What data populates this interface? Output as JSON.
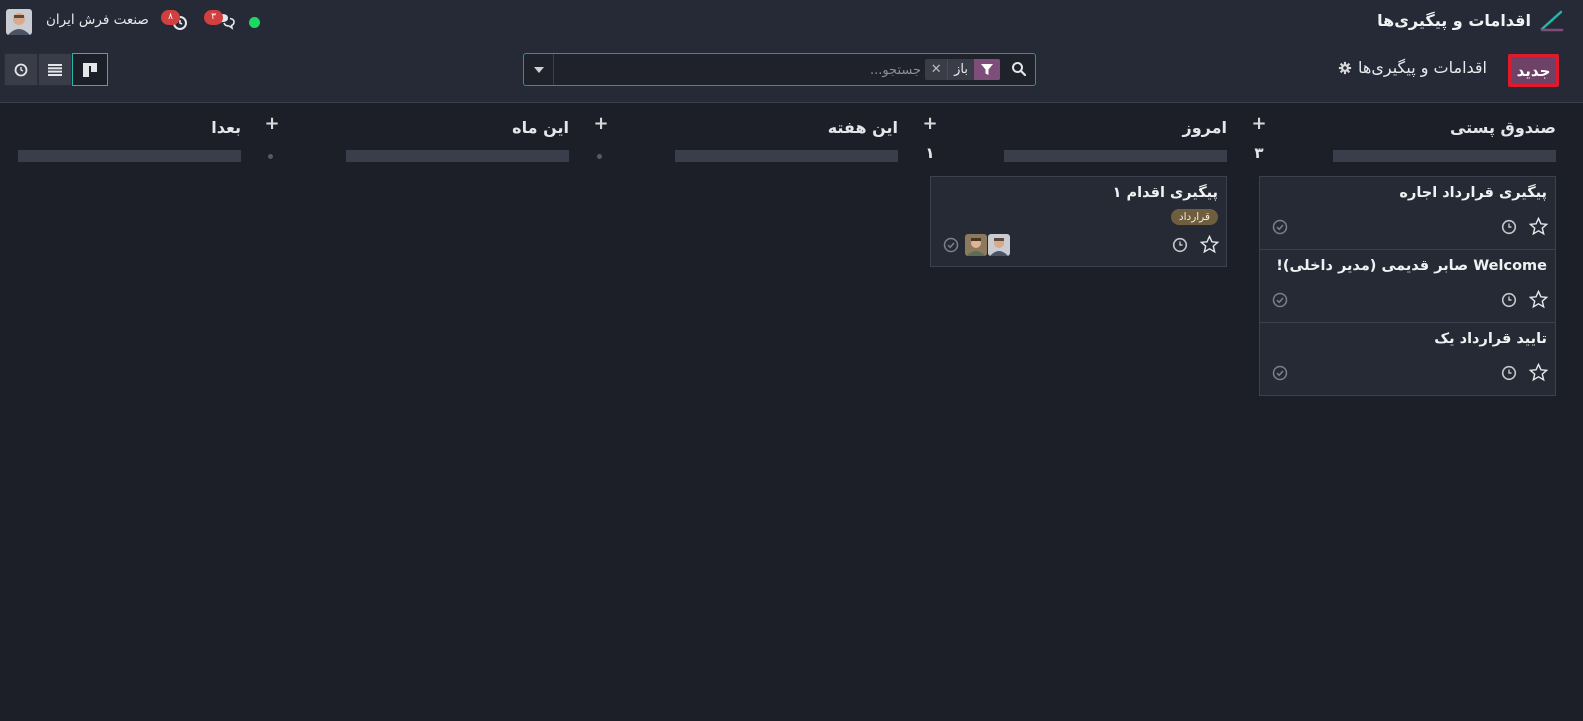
{
  "app": {
    "title": "اقدامات و پیگیری‌ها",
    "company": "صنعت فرش ایران"
  },
  "systray": {
    "activity_count": "۸",
    "messages_count": "۳"
  },
  "control": {
    "new_label": "جدید",
    "breadcrumb": "اقدامات و پیگیری‌ها",
    "search_placeholder": "جستجو...",
    "facet_label": "باز"
  },
  "columns": [
    {
      "title": "صندوق پستی",
      "count": "۳",
      "cards": [
        {
          "title": "پیگیری قرارداد اجاره"
        },
        {
          "title": "Welcome صابر قدیمی (مدیر داخلی)!"
        },
        {
          "title": "تایید قرارداد یک"
        }
      ]
    },
    {
      "title": "امروز",
      "count": "۱",
      "cards": [
        {
          "title": "پیگیری اقدام ۱",
          "tag": "قرارداد"
        }
      ]
    },
    {
      "title": "این هفته",
      "count": ""
    },
    {
      "title": "این ماه",
      "count": ""
    },
    {
      "title": "بعدا",
      "count": ""
    }
  ],
  "colors": {
    "accent": "#24b6a8",
    "primary_button": "#6d4266",
    "highlight_border": "#e0192b",
    "status_online": "#1ed760",
    "badge": "#d23f3f"
  },
  "icons": [
    "app-logo-icon",
    "gear-icon",
    "search-icon",
    "filter-icon",
    "close-icon",
    "caret-down-icon",
    "kanban-view-icon",
    "list-view-icon",
    "activity-view-icon",
    "star-icon",
    "clock-icon",
    "check-circle-icon",
    "chat-icon",
    "activity-icon"
  ]
}
